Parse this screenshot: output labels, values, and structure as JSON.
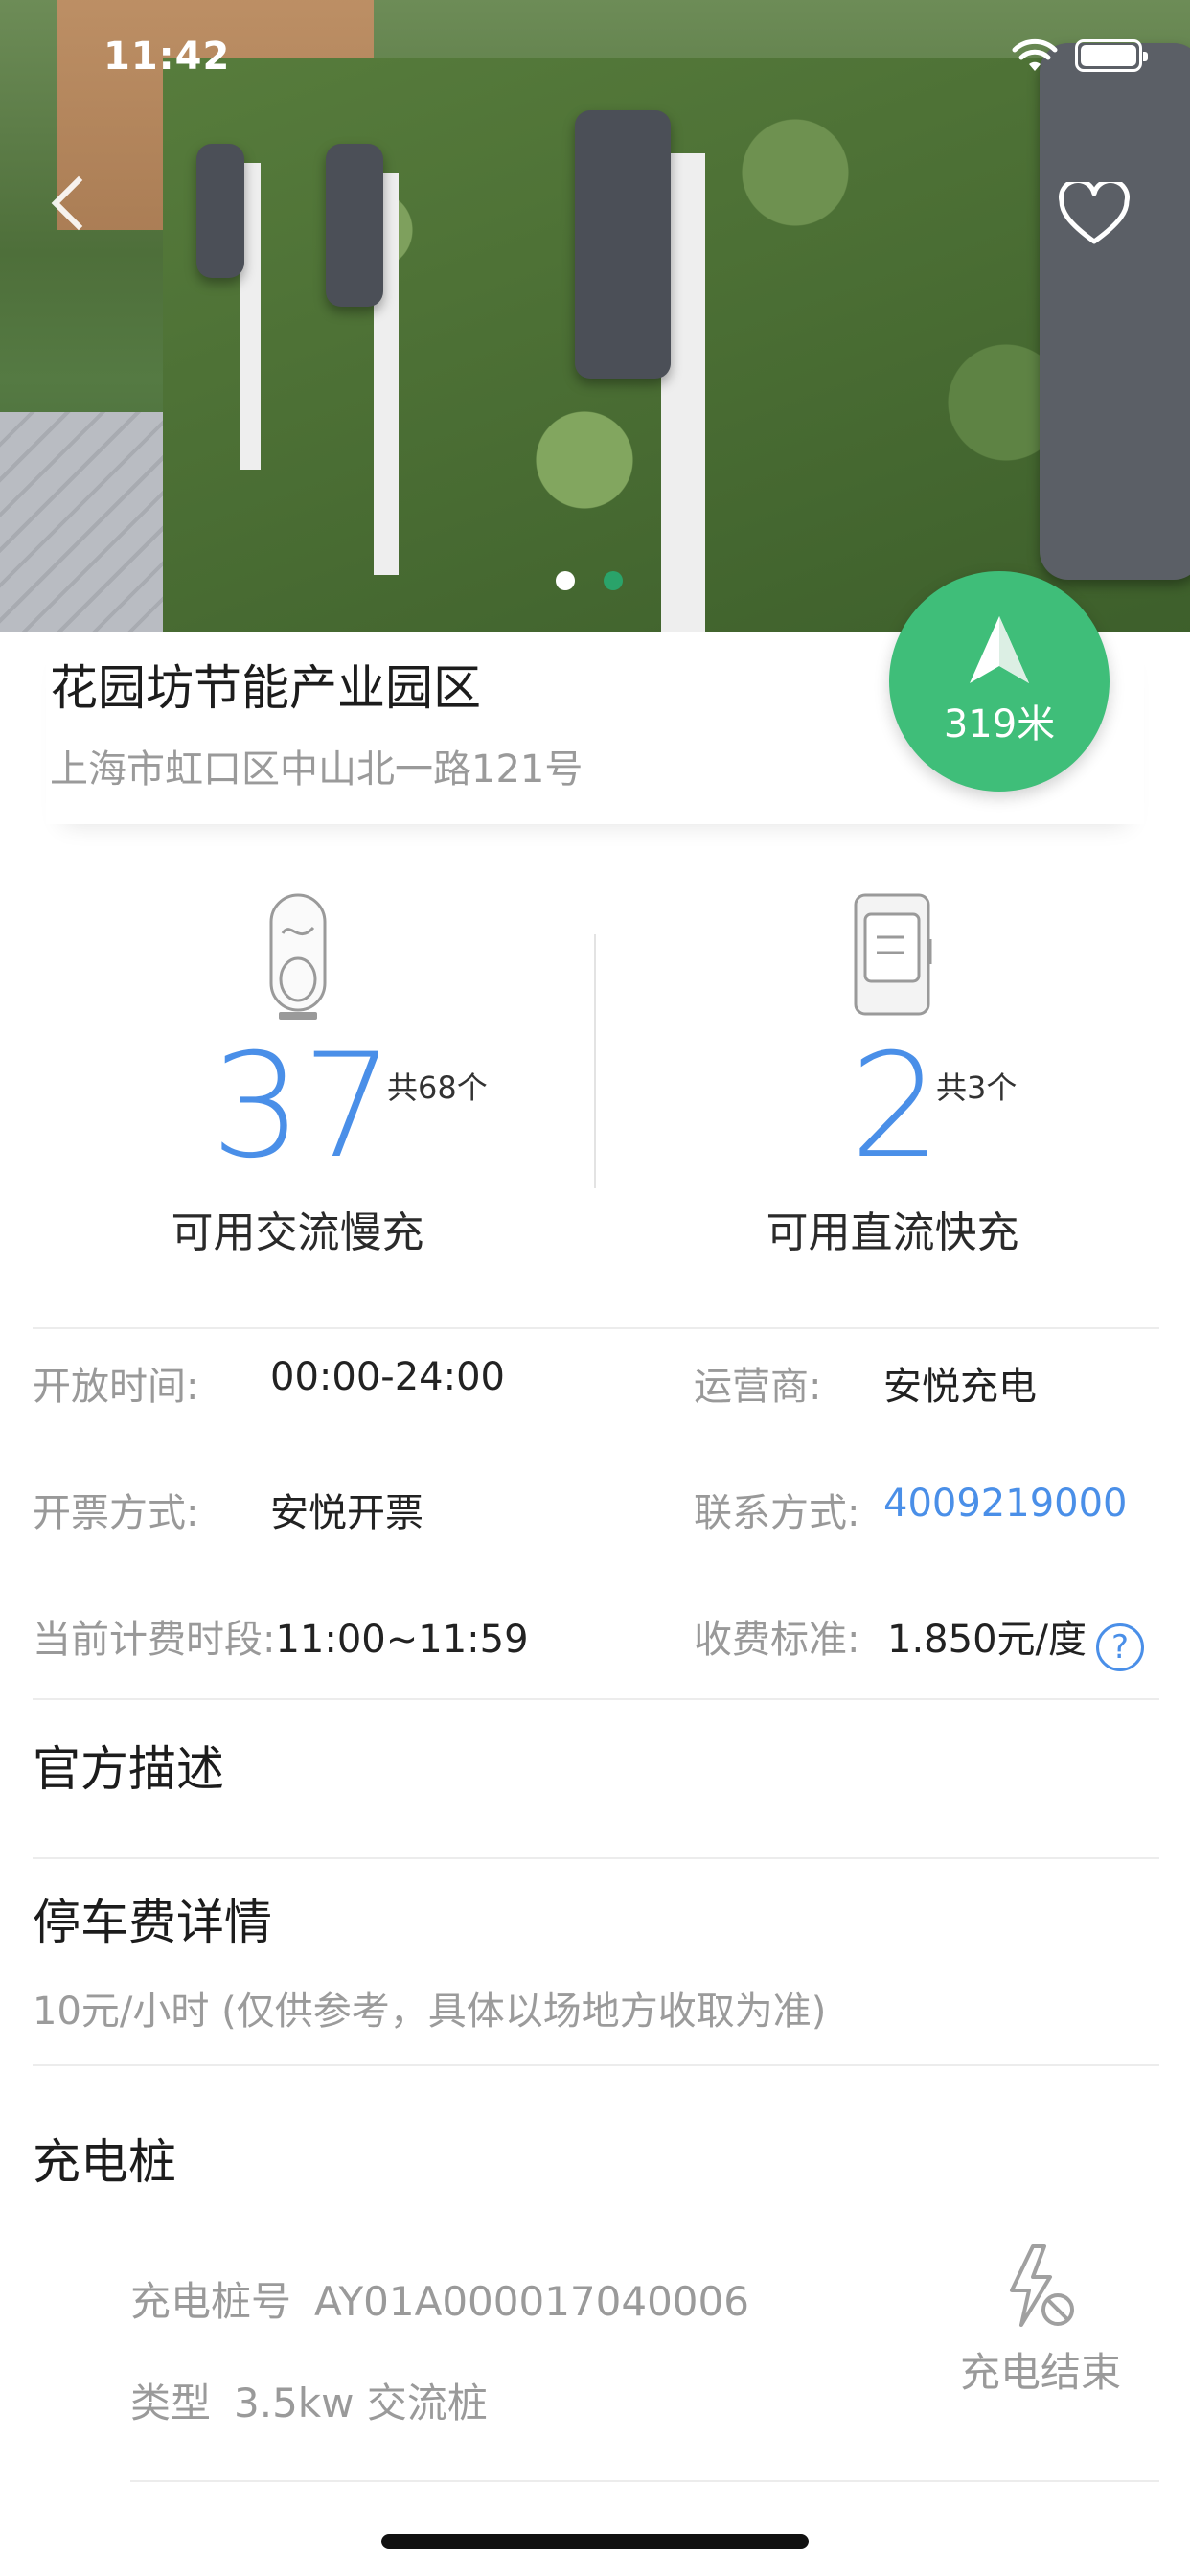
{
  "status_bar": {
    "time": "11:42"
  },
  "hero": {
    "carousel_pages": 2,
    "active_page": 1
  },
  "station": {
    "name": "花园坊节能产业园区",
    "address": "上海市虹口区中山北一路121号",
    "distance": "319米"
  },
  "availability": {
    "ac": {
      "count": "37",
      "total": "共68个",
      "label": "可用交流慢充"
    },
    "dc": {
      "count": "2",
      "total": "共3个",
      "label": "可用直流快充"
    }
  },
  "info": {
    "open_hours_label": "开放时间:",
    "open_hours_value": "00:00-24:00",
    "operator_label": "运营商:",
    "operator_value": "安悦充电",
    "invoice_label": "开票方式:",
    "invoice_value": "安悦开票",
    "contact_label": "联系方式:",
    "contact_value": "4009219000",
    "period_label": "当前计费时段:",
    "period_value": "11:00~11:59",
    "fee_label": "收费标准:",
    "fee_value": "1.850元/度",
    "help_glyph": "?"
  },
  "sections": {
    "description_title": "官方描述",
    "parking_title": "停车费详情",
    "parking_desc": "10元/小时 (仅供参考，具体以场地方收取为准)",
    "chargers_title": "充电桩"
  },
  "chargers": [
    {
      "id_label": "充电桩号",
      "id_value": "AY01A000017040006",
      "type_label": "类型",
      "type_value": "3.5kw 交流桩",
      "status": "充电结束"
    }
  ],
  "colors": {
    "accent": "#4a8fe8",
    "nav_green": "#3fbe79"
  },
  "icons": {
    "back": "chevron-left-icon",
    "favorite": "heart-outline-icon",
    "navigate": "navigation-arrow-icon",
    "ac_charger": "ac-charger-icon",
    "dc_charger": "dc-charger-icon",
    "help": "question-circle-icon",
    "charger_status": "charge-ended-icon"
  }
}
